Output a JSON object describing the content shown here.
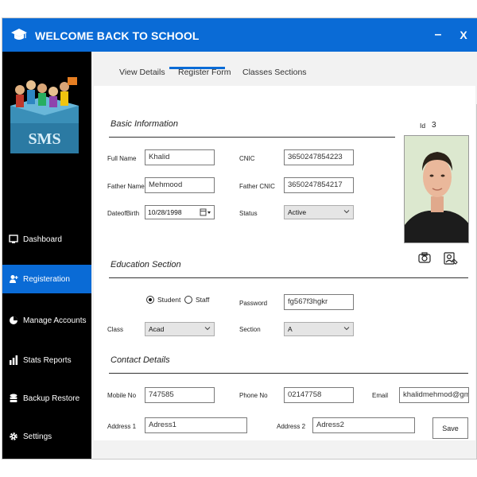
{
  "window": {
    "title": "WELCOME BACK TO SCHOOL",
    "minimize": "–",
    "close": "X"
  },
  "sidebar": {
    "banner_text": "SMS",
    "items": [
      {
        "label": "Dashboard",
        "icon": "monitor-icon"
      },
      {
        "label": "Registeration",
        "icon": "add-user-icon"
      },
      {
        "label": "Manage Accounts",
        "icon": "pie-chart-icon"
      },
      {
        "label": "Stats Reports",
        "icon": "bar-chart-icon"
      },
      {
        "label": "Backup Restore",
        "icon": "database-icon"
      },
      {
        "label": "Settings",
        "icon": "gear-icon"
      }
    ],
    "active": "Registeration"
  },
  "tabs": [
    {
      "label": "View Details"
    },
    {
      "label": "Register Form"
    },
    {
      "label": "Classes Sections"
    }
  ],
  "form": {
    "basic_title": "Basic Information",
    "id_label": "Id",
    "id_value": "3",
    "full_name_label": "Full Name",
    "full_name": "Khalid",
    "cnic_label": "CNIC",
    "cnic": "3650247854223",
    "father_name_label": "Father Name",
    "father_name": "Mehmood",
    "father_cnic_label": "Father CNIC",
    "father_cnic": "3650247854217",
    "dob_label": "DateofBirth",
    "dob": "10/28/1998",
    "status_label": "Status",
    "status": "Active",
    "education_title": "Education Section",
    "role_student": "Student",
    "role_staff": "Staff",
    "role_selected": "Student",
    "password_label": "Password",
    "password": "fg567f3hgkr",
    "class_label": "Class",
    "class": "Acad",
    "section_label": "Section",
    "section": "A",
    "contact_title": "Contact Details",
    "mobile_label": "Mobile No",
    "mobile": "747585",
    "phone_label": "Phone No",
    "phone": "02147758",
    "email_label": "Email",
    "email": "khalidmehmod@gma",
    "address1_label": "Address 1",
    "address1": "Adress1",
    "address2_label": "Address 2",
    "address2": "Adress2",
    "save_label": "Save"
  },
  "colors": {
    "accent": "#0a6bd6",
    "sidebar": "#000000",
    "background": "#f2f2f2"
  }
}
